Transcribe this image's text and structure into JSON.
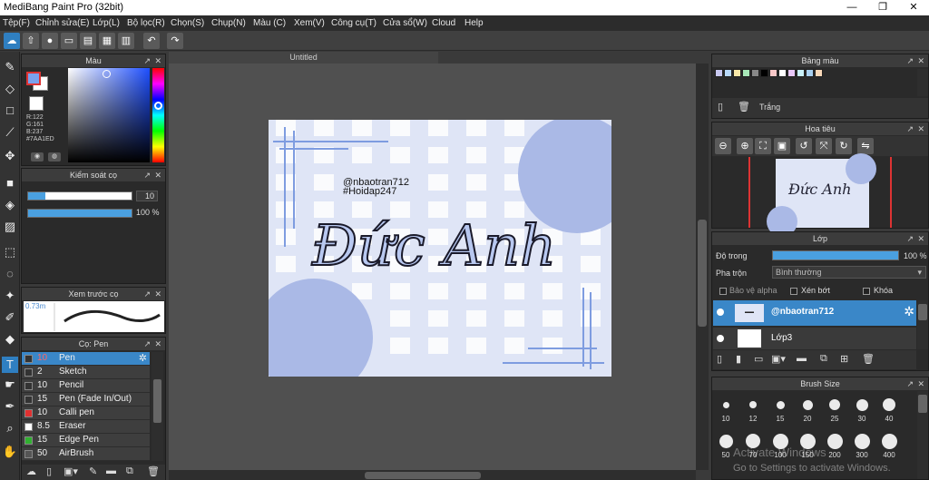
{
  "window": {
    "title": "MediBang Paint Pro (32bit)",
    "min": "—",
    "max": "❐",
    "close": "✕"
  },
  "menu": [
    "Tệp(F)",
    "Chỉnh sửa(E)",
    "Lớp(L)",
    "Bộ lọc(R)",
    "Chọn(S)",
    "Chụp(N)",
    "Màu (C)",
    "Xem(V)",
    "Công cụ(T)",
    "Cửa sổ(W)",
    "Cloud",
    "Help"
  ],
  "toolbar": {
    "undo_icon": "↶",
    "redo_icon": "↷"
  },
  "color_panel": {
    "title": "Màu",
    "r": "R:122",
    "g": "G:161",
    "b": "B:237",
    "hex": "#7AA1ED",
    "primary": "#7aa1ed",
    "secondary": "#ffffff"
  },
  "brush_control": {
    "title": "Kiểm soát cọ",
    "size": "10",
    "opacity": "100 %",
    "opacity_value": 100
  },
  "preview": {
    "title": "Xem trước cọ",
    "size": "0.73m"
  },
  "brushes": {
    "title": "Cọ: Pen",
    "items": [
      {
        "size": "10",
        "name": "Pen",
        "color": "#333333"
      },
      {
        "size": "2",
        "name": "Sketch",
        "color": "#333333"
      },
      {
        "size": "10",
        "name": "Pencil",
        "color": "#333333"
      },
      {
        "size": "15",
        "name": "Pen (Fade In/Out)",
        "color": "#333333"
      },
      {
        "size": "10",
        "name": "Calli pen",
        "color": "#e03030"
      },
      {
        "size": "8.5",
        "name": "Eraser",
        "color": "#ffffff"
      },
      {
        "size": "15",
        "name": "Edge Pen",
        "color": "#30b030"
      },
      {
        "size": "50",
        "name": "AirBrush",
        "color": "#555555"
      }
    ]
  },
  "document": {
    "tab": "Untitled",
    "handle": "@nbaotran712",
    "tag": "#Hoidap247",
    "art_text": "Đức Anh"
  },
  "palette": {
    "title": "Bảng màu",
    "swatches": [
      "#c8c8f0",
      "#b8d8f8",
      "#f8e8a8",
      "#a8e8b8",
      "#888888",
      "#000000",
      "#f8c8c8",
      "#ffffff",
      "#e8c8f8",
      "#c8f0f8",
      "#a8d0f0",
      "#f8d8b8"
    ],
    "color_name": "Trắng"
  },
  "navigator": {
    "title": "Hoa tiêu"
  },
  "layers": {
    "title": "Lớp",
    "opacity_label": "Độ trong",
    "opacity": "100 %",
    "opacity_value": 100,
    "blend_label": "Pha trộn",
    "blend": "Bình thường",
    "alpha_label": "Bảo vệ alpha",
    "clip_label": "Xén bớt",
    "lock_label": "Khóa",
    "items": [
      {
        "name": "@nbaotran712",
        "selected": true
      },
      {
        "name": "Lớp3",
        "selected": false
      }
    ]
  },
  "brush_size": {
    "title": "Brush Size",
    "sizes": [
      "10",
      "12",
      "15",
      "20",
      "25",
      "30",
      "40",
      "50",
      "70",
      "100",
      "150",
      "200",
      "300",
      "400"
    ]
  },
  "watermark": {
    "line1": "Activate Windows",
    "line2": "Go to Settings to activate Windows."
  }
}
